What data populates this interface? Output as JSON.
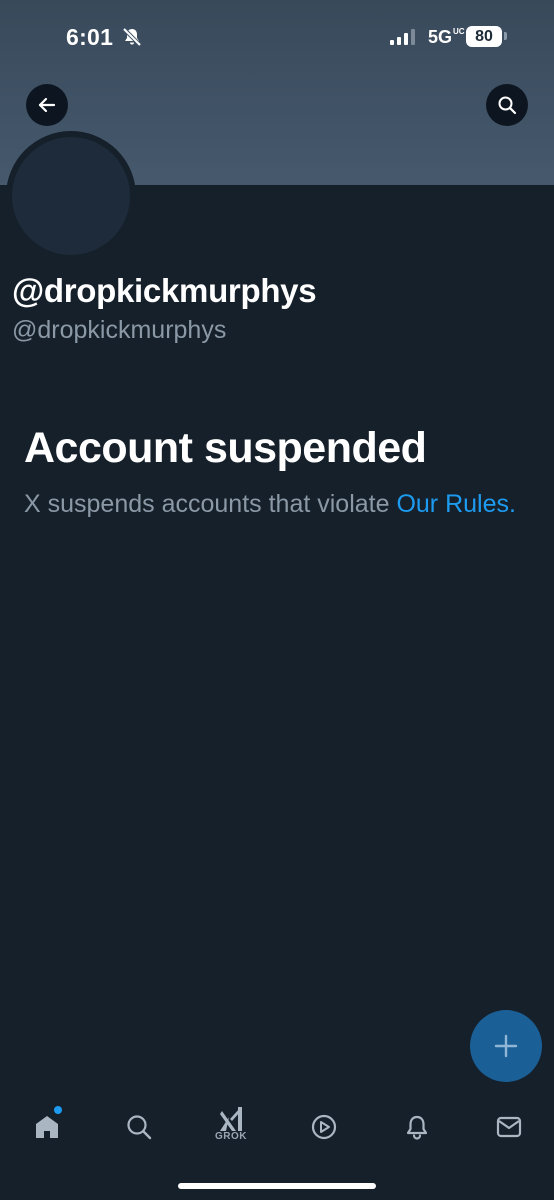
{
  "status_bar": {
    "time": "6:01",
    "network": "5G",
    "network_sub": "UC",
    "battery": "80"
  },
  "profile": {
    "display_name": "@dropkickmurphys",
    "handle": "@dropkickmurphys"
  },
  "suspension": {
    "title": "Account suspended",
    "message": "X suspends accounts that violate ",
    "rules_link": "Our Rules",
    "period": "."
  },
  "tabs": [
    {
      "icon": "home-icon",
      "notification_dot": true
    },
    {
      "icon": "search-icon"
    },
    {
      "icon": "grok-icon",
      "label": "GROK"
    },
    {
      "icon": "video-icon"
    },
    {
      "icon": "notifications-icon"
    },
    {
      "icon": "messages-icon"
    }
  ],
  "colors": {
    "background": "#15202b",
    "banner": "#46596d",
    "accent": "#1d9bf0",
    "secondary_text": "#8b98a5",
    "fab": "#1a5f96"
  }
}
